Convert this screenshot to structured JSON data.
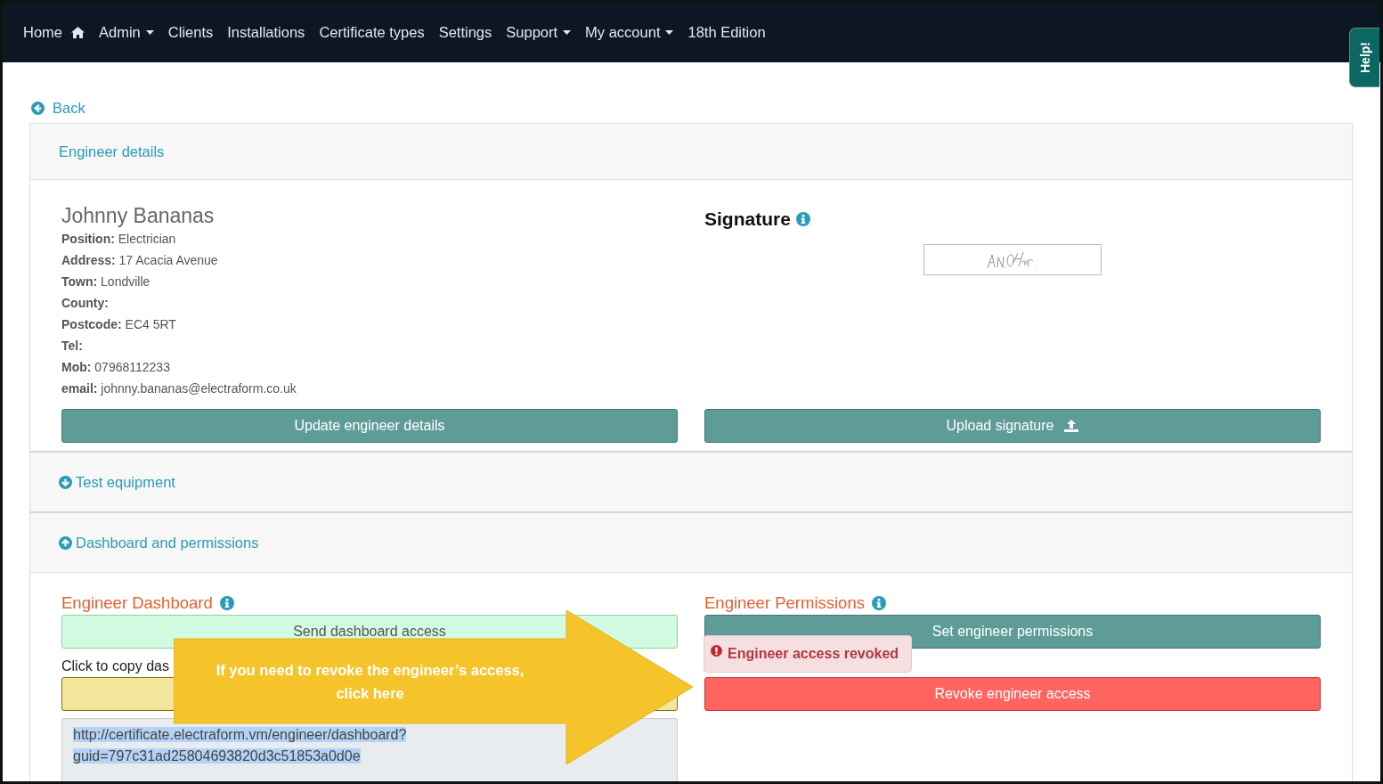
{
  "nav": {
    "items": [
      {
        "label": "Home",
        "kind": "home"
      },
      {
        "label": "Admin",
        "kind": "dropdown"
      },
      {
        "label": "Clients",
        "kind": "link"
      },
      {
        "label": "Installations",
        "kind": "link"
      },
      {
        "label": "Certificate types",
        "kind": "link"
      },
      {
        "label": "Settings",
        "kind": "link"
      },
      {
        "label": "Support",
        "kind": "dropdown"
      },
      {
        "label": "My account",
        "kind": "dropdown"
      },
      {
        "label": "18th Edition",
        "kind": "link"
      }
    ]
  },
  "help_tab": {
    "label": "Help!"
  },
  "back_link": {
    "label": "Back"
  },
  "engineer_details": {
    "header": "Engineer details",
    "name": "Johnny Bananas",
    "fields": [
      {
        "label": "Position:",
        "value": "Electrician"
      },
      {
        "label": "Address:",
        "value": "17 Acacia Avenue"
      },
      {
        "label": "Town:",
        "value": "Londville"
      },
      {
        "label": "County:"
      },
      {
        "label": "Postcode:",
        "value": "EC4 5RT"
      },
      {
        "label": "Tel:"
      },
      {
        "label": "Mob:",
        "value": "07968112233"
      },
      {
        "label": "email:",
        "value": "johnny.bananas@electraform.co.uk"
      }
    ],
    "update_button": "Update engineer details",
    "signature_title": "Signature",
    "upload_button": "Upload signature"
  },
  "test_equipment": {
    "header": "Test equipment",
    "expanded": false
  },
  "dashboard_permissions": {
    "header": "Dashboard and permissions",
    "expanded": true,
    "dashboard": {
      "title": "Engineer Dashboard",
      "send_button": "Send dashboard access",
      "copy_label": "Click to copy das",
      "link_lines": [
        "http://certificate.electraform.vm/engineer/dashboard?",
        "guid=797c31ad25804693820d3c51853a0d0e"
      ]
    },
    "permissions": {
      "title": "Engineer Permissions",
      "set_button": "Set engineer permissions",
      "revoke_button": "Revoke engineer access",
      "tooltip": "Engineer access revoked"
    }
  },
  "callout": {
    "text": "If you need to revoke the engineer’s access, click here"
  }
}
